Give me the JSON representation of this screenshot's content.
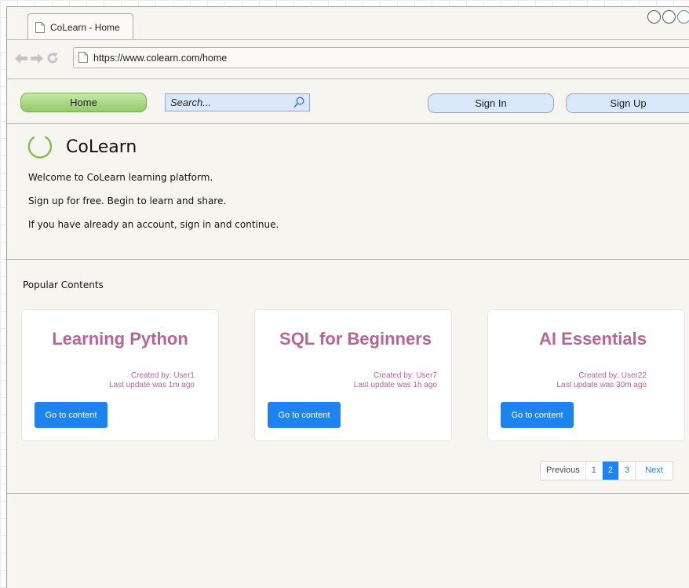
{
  "browser": {
    "tab_title": "CoLearn - Home",
    "url": "https://www.colearn.com/home"
  },
  "toolbar": {
    "home_label": "Home",
    "search_placeholder": "Search...",
    "sign_in_label": "Sign In",
    "sign_up_label": "Sign Up"
  },
  "hero": {
    "brand": "CoLearn",
    "welcome": "Welcome to CoLearn learning platform.",
    "signup_text": "Sign up for free. Begin to learn and share.",
    "signin_text": "If you have already an account, sign in and continue."
  },
  "popular": {
    "heading": "Popular Contents",
    "cards": [
      {
        "title": "Learning Python",
        "author": "Created by: User1",
        "updated": "Last update was 1m ago",
        "button": "Go to content"
      },
      {
        "title": "SQL for Beginners",
        "author": "Created by: User7",
        "updated": "Last update was 1h ago",
        "button": "Go to content"
      },
      {
        "title": "AI Essentials",
        "author": "Created by: User22",
        "updated": "Last update was 30m ago",
        "button": "Go to content"
      }
    ]
  },
  "pagination": {
    "previous": "Previous",
    "pages": [
      "1",
      "2",
      "3"
    ],
    "current": "2",
    "next": "Next"
  },
  "colors": {
    "accent": "#1d83ee",
    "card_text": "#b56696",
    "home_button": "#a9d985",
    "pill_button": "#dbe8fb",
    "logo": "#7cc04b"
  },
  "icons": [
    "page-icon",
    "back-arrow-icon",
    "forward-arrow-icon",
    "reload-icon",
    "search-icon",
    "colearn-logo-icon"
  ]
}
